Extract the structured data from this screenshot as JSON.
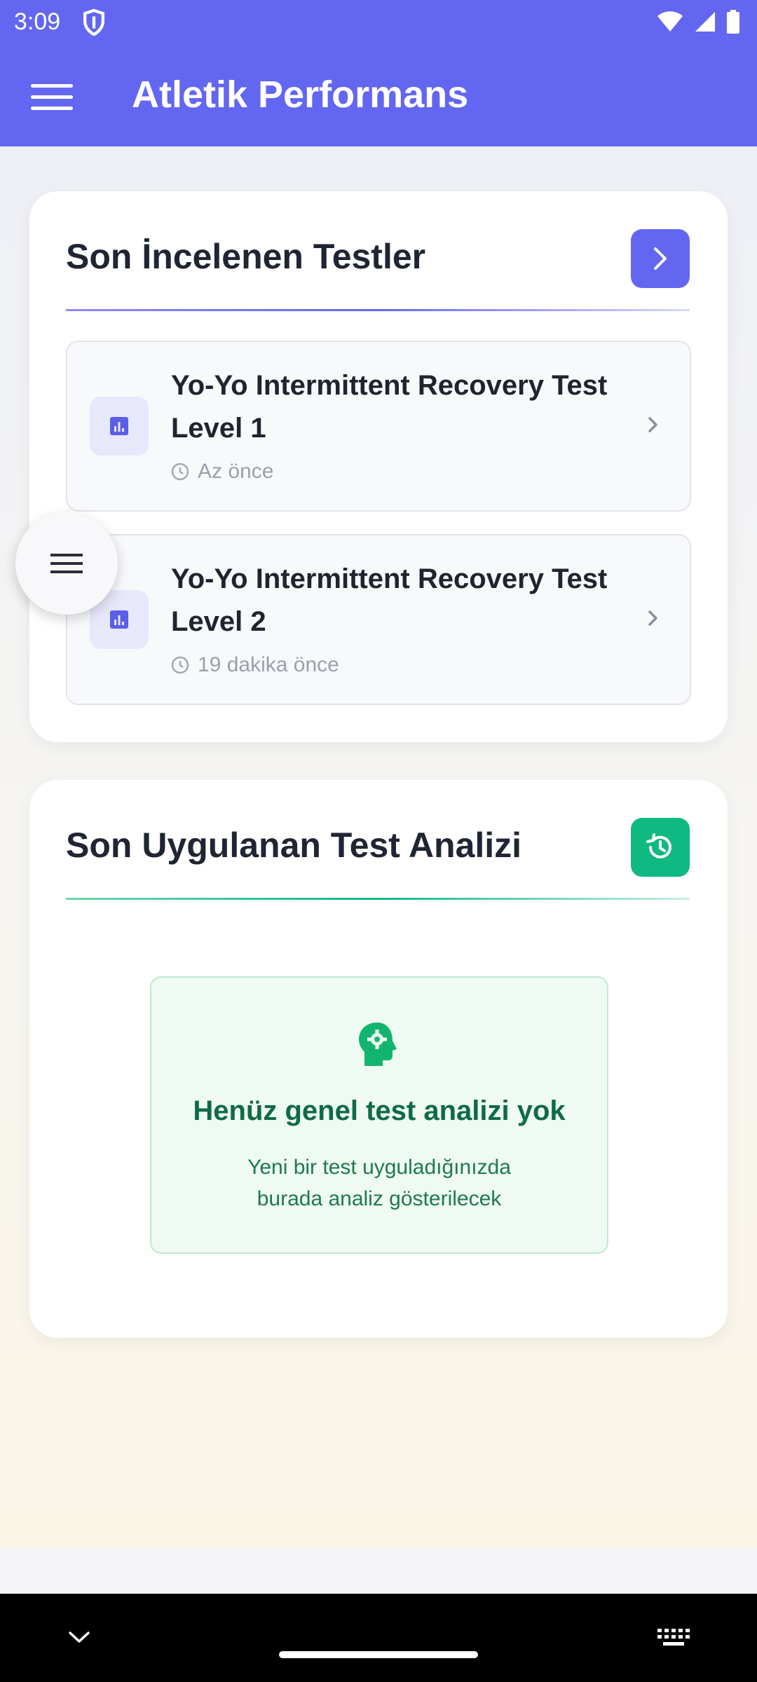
{
  "status_bar": {
    "time": "3:09"
  },
  "app_bar": {
    "title": "Atletik Performans"
  },
  "recent_tests": {
    "title": "Son İncelenen Testler",
    "accent": "#6366f1",
    "items": [
      {
        "name": "Yo-Yo Intermittent Recovery Test Level 1",
        "time": "Az önce"
      },
      {
        "name": "Yo-Yo Intermittent Recovery Test Level 2",
        "time": "19 dakika önce"
      }
    ]
  },
  "analysis": {
    "title": "Son Uygulanan Test Analizi",
    "accent": "#10b981",
    "empty_title": "Henüz genel test analizi yok",
    "empty_line1": "Yeni bir test uyguladığınızda",
    "empty_line2": "burada analiz gösterilecek"
  }
}
